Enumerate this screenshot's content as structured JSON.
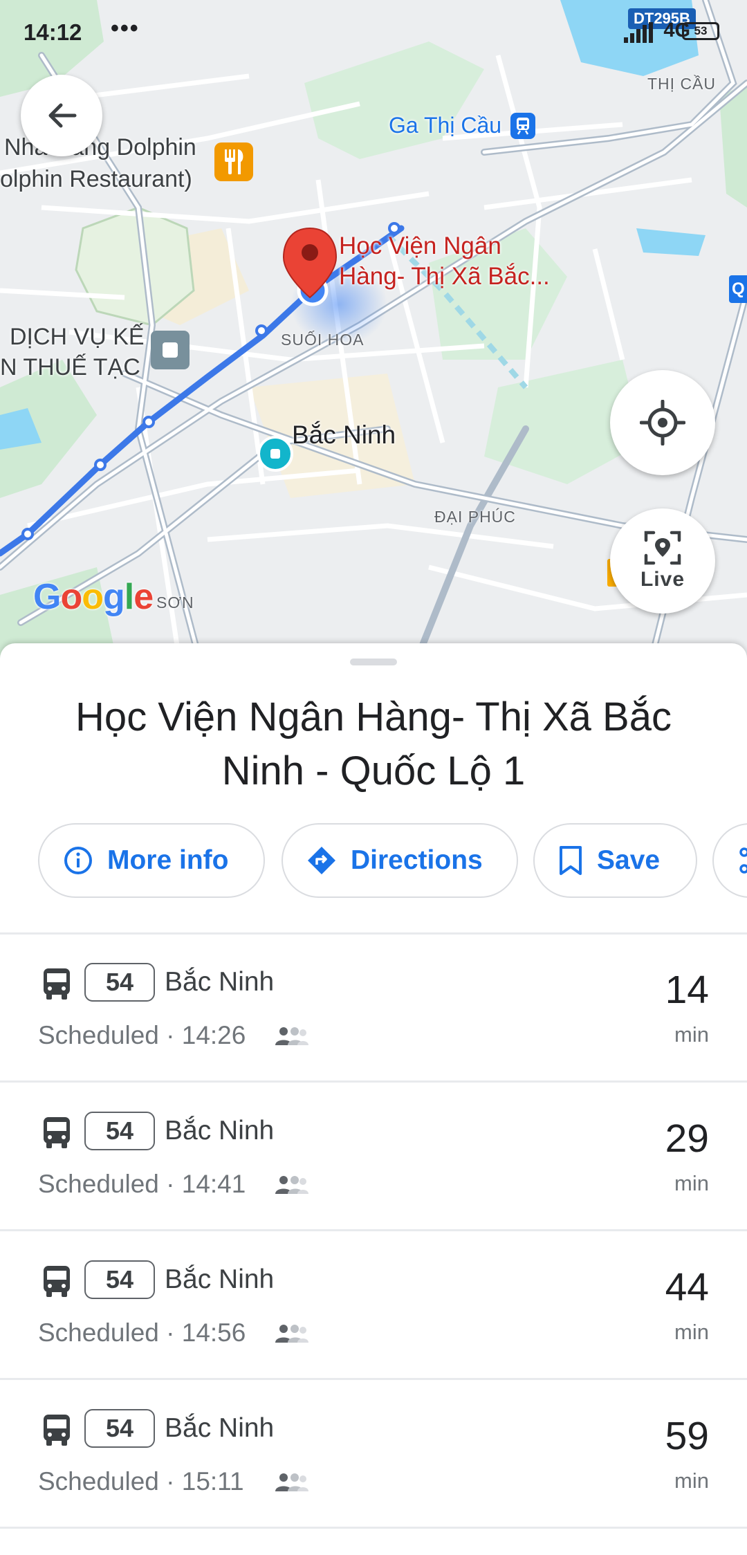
{
  "status_bar": {
    "time": "14:12",
    "menu_dots": "•••",
    "network": "4G",
    "battery": "53"
  },
  "map": {
    "road_shield": "DT295B",
    "labels": {
      "dolphin_line1": "Nhà Hàng Dolphin",
      "dolphin_line2": "olphin Restaurant)",
      "ga_thi_cau": "Ga Thị Cầu",
      "thi_cau": "THỊ CẦU",
      "marker_line1": "Học Viện Ngân",
      "marker_line2": "Hàng- Thị Xã Bắc...",
      "dich_vu_line1": "DỊCH VỤ KẾ",
      "dich_vu_line2": "N THUẾ TẠC",
      "suoi_hoa": "SUỐI HOA",
      "bac_ninh": "Bắc Ninh",
      "dai_phuc": "ĐẠI PHÚC",
      "son": "SƠN",
      "edge_letter": "Q"
    },
    "live_label": "Live",
    "icons": {
      "back": "arrow-left-icon",
      "locate": "my-location-icon",
      "live": "live-view-icon",
      "restaurant": "restaurant-icon",
      "train": "train-station-icon",
      "pin": "location-pin-icon"
    }
  },
  "place": {
    "title": "Học Viện Ngân Hàng- Thị Xã Bắc Ninh - Quốc Lộ 1"
  },
  "actions": {
    "more_info": "More info",
    "directions": "Directions",
    "save": "Save"
  },
  "departures": [
    {
      "route": "54",
      "destination": "Bắc Ninh",
      "schedule": "Scheduled · 14:26",
      "minutes": "14",
      "unit": "min"
    },
    {
      "route": "54",
      "destination": "Bắc Ninh",
      "schedule": "Scheduled · 14:41",
      "minutes": "29",
      "unit": "min"
    },
    {
      "route": "54",
      "destination": "Bắc Ninh",
      "schedule": "Scheduled · 14:56",
      "minutes": "44",
      "unit": "min"
    },
    {
      "route": "54",
      "destination": "Bắc Ninh",
      "schedule": "Scheduled · 15:11",
      "minutes": "59",
      "unit": "min"
    }
  ],
  "colors": {
    "accent": "#1a73e8",
    "route_line": "#3c78e8",
    "pin": "#ea4335",
    "park": "#c8e6c9",
    "water": "#8ed6f5"
  }
}
